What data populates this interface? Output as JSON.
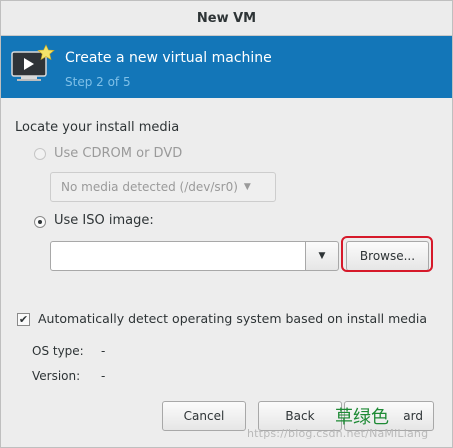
{
  "window": {
    "title": "New VM"
  },
  "header": {
    "title": "Create a new virtual machine",
    "step": "Step 2 of 5"
  },
  "media": {
    "section_label": "Locate your install media",
    "cdrom_label": "Use CDROM or DVD",
    "cdrom_selected_value": "No media detected (/dev/sr0)",
    "iso_label": "Use ISO image:",
    "iso_path_value": "",
    "browse_label": "Browse..."
  },
  "detect": {
    "checkbox_label": "Automatically detect operating system based on install media",
    "checked": true,
    "os_type_label": "OS type:",
    "os_type_value": "-",
    "version_label": "Version:",
    "version_value": "-"
  },
  "buttons": {
    "cancel": "Cancel",
    "back": "Back",
    "forward": "ard"
  },
  "overlay": {
    "annotation": "草绿色",
    "watermark": "https://blog.csdn.net/NaMiLiang"
  },
  "colors": {
    "header_bg": "#1376b8",
    "highlight": "#d6192a",
    "annotation": "#1e8a35"
  },
  "icons": {
    "header": "vm-monitor-star-icon",
    "dropdown": "chevron-down-icon",
    "check": "checkmark-icon"
  }
}
